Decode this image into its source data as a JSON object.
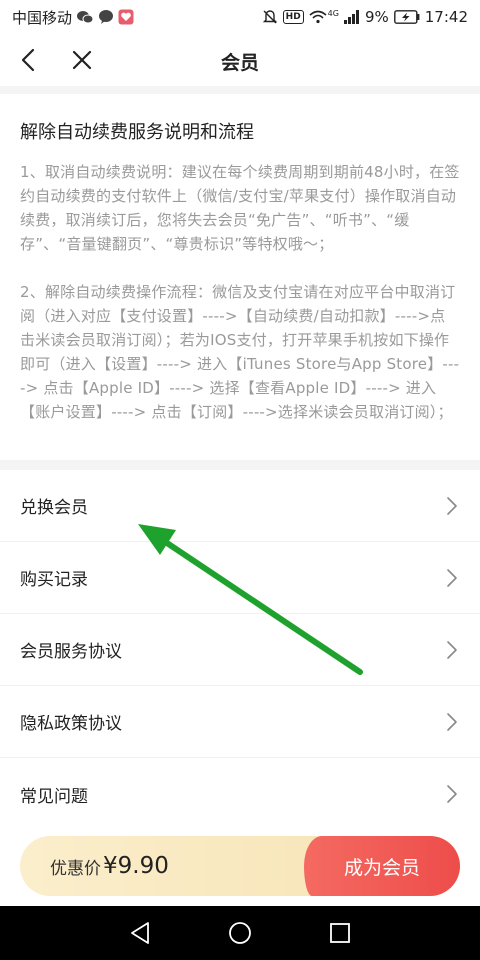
{
  "status_bar": {
    "carrier": "中国移动",
    "battery": "9%",
    "time": "17:42",
    "hd_badge": "HD",
    "network": "4G",
    "icons": [
      "wechat-icon",
      "chat-bubble-icon",
      "app-badge-icon",
      "mute-icon",
      "wifi-icon",
      "signal-icon",
      "battery-icon"
    ]
  },
  "header": {
    "title": "会员",
    "back_icon": "chevron-left-icon",
    "close_icon": "close-icon"
  },
  "info": {
    "title": "解除自动续费服务说明和流程",
    "paragraphs": [
      "1、取消自动续费说明：建议在每个续费周期到期前48小时，在签约自动续费的支付软件上（微信/支付宝/苹果支付）操作取消自动续费，取消续订后，您将失去会员“免广告”、“听书”、“缓存”、“音量键翻页”、“尊贵标识”等特权哦～；",
      "2、解除自动续费操作流程：微信及支付宝请在对应平台中取消订阅（进入对应【支付设置】---->【自动续费/自动扣款】---->点击米读会员取消订阅）；若为IOS支付，打开苹果手机按如下操作即可（进入【设置】----> 进入【iTunes Store与App Store】----> 点击【Apple ID】----> 选择【查看Apple ID】----> 进入【账户设置】----> 点击【订阅】---->选择米读会员取消订阅）；"
    ]
  },
  "menu": {
    "items": [
      {
        "label": "兑换会员"
      },
      {
        "label": "购买记录"
      },
      {
        "label": "会员服务协议"
      },
      {
        "label": "隐私政策协议"
      },
      {
        "label": "常见问题"
      }
    ]
  },
  "purchase": {
    "price_label": "优惠价",
    "price_value": "¥9.90",
    "button_label": "成为会员"
  },
  "system_nav": {
    "icons": [
      "back-triangle-icon",
      "home-circle-icon",
      "recents-square-icon"
    ]
  },
  "colors": {
    "accent_red": "#ee4d4a",
    "price_bg": "#f7e3b4",
    "annotation_green": "#1fa12e"
  }
}
